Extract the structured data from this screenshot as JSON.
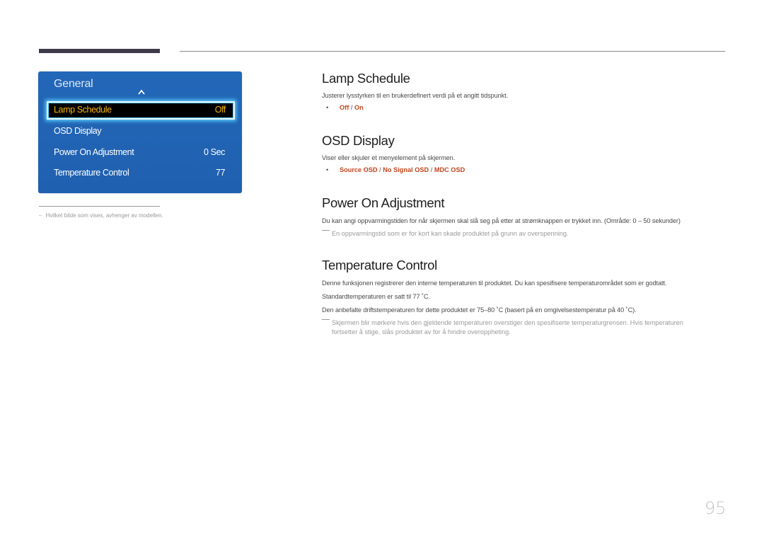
{
  "osd_menu": {
    "title": "General",
    "items": [
      {
        "label": "Lamp Schedule",
        "value": "Off",
        "selected": true
      },
      {
        "label": "OSD Display",
        "value": ""
      },
      {
        "label": "Power On Adjustment",
        "value": "0 Sec"
      },
      {
        "label": "Temperature Control",
        "value": "77"
      }
    ],
    "selected_color": "#f4b400",
    "panel_color": "#2265b6"
  },
  "left_note": {
    "dash": "–",
    "text": "Hvilket bilde som vises, avhenger av modellen."
  },
  "sections": {
    "lamp_schedule": {
      "title": "Lamp Schedule",
      "description": "Justerer lysstyrken til en brukerdefinert verdi på et angitt tidspunkt.",
      "options": [
        "Off",
        "On"
      ]
    },
    "osd_display": {
      "title": "OSD Display",
      "description": "Viser eller skjuler et menyelement på skjermen.",
      "options": [
        "Source OSD",
        "No Signal OSD",
        "MDC OSD"
      ]
    },
    "power_on_adjustment": {
      "title": "Power On Adjustment",
      "description": "Du kan angi oppvarmingstiden for når skjermen skal slå seg på etter at strømknappen er trykket inn. (Område: 0 – 50 sekunder)",
      "note": "En oppvarmingstid som er for kort kan skade produktet på grunn av overspenning."
    },
    "temperature_control": {
      "title": "Temperature Control",
      "description_line1": "Denne funksjonen registrerer den interne temperaturen til produktet. Du kan spesifisere temperaturområdet som er godtatt.",
      "description_line2": "Standardtemperaturen er satt til 77 ˚C.",
      "description_line3": "Den anbefalte driftstemperaturen for dette produktet er 75–80 ˚C (basert på en omgivelsestemperatur på 40 ˚C).",
      "note_line1": "Skjermen blir mørkere hvis den gjeldende temperaturen overstiger den spesifiserte temperaturgrensen. Hvis temperaturen",
      "note_line2": "fortsetter å stige, slås produktet av for å hindre overoppheting."
    }
  },
  "option_separator": "/",
  "accent_color": "#c2451e",
  "page_number": "95"
}
